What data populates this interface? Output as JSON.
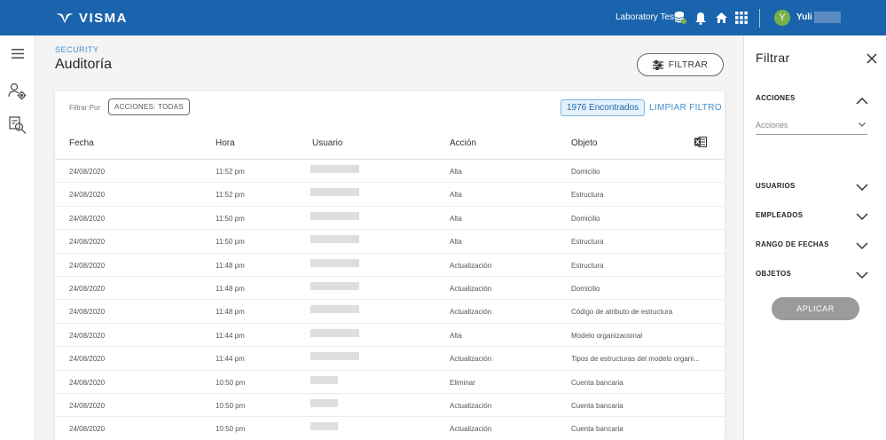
{
  "app": {
    "logo_text": "VISMA",
    "company": "Laboratory Test",
    "user_initial": "Y",
    "user_name": "Yuli"
  },
  "header": {
    "section": "SECURITY",
    "title": "Auditoría",
    "filter_button": "FILTRAR"
  },
  "toolbar": {
    "filter_by": "Filtrar Por",
    "chip": "ACCIONES: TODAS",
    "found": "1976 Encontrados",
    "clear": "LIMPIAR FILTRO"
  },
  "table": {
    "columns": [
      "Fecha",
      "Hora",
      "Usuario",
      "Acción",
      "Objeto"
    ],
    "rows": [
      {
        "fecha": "24/08/2020",
        "hora": "11:52 pm",
        "accion": "Alta",
        "objeto": "Domicilio",
        "user_blur": "long"
      },
      {
        "fecha": "24/08/2020",
        "hora": "11:52 pm",
        "accion": "Alta",
        "objeto": "Estructura",
        "user_blur": "long"
      },
      {
        "fecha": "24/08/2020",
        "hora": "11:50 pm",
        "accion": "Alta",
        "objeto": "Domicilio",
        "user_blur": "long"
      },
      {
        "fecha": "24/08/2020",
        "hora": "11:50 pm",
        "accion": "Alta",
        "objeto": "Estructura",
        "user_blur": "long"
      },
      {
        "fecha": "24/08/2020",
        "hora": "11:48 pm",
        "accion": "Actualización",
        "objeto": "Estructura",
        "user_blur": "long"
      },
      {
        "fecha": "24/08/2020",
        "hora": "11:48 pm",
        "accion": "Actualización",
        "objeto": "Domicilio",
        "user_blur": "long"
      },
      {
        "fecha": "24/08/2020",
        "hora": "11:48 pm",
        "accion": "Actualización",
        "objeto": "Código de atributo de estructura",
        "user_blur": "long"
      },
      {
        "fecha": "24/08/2020",
        "hora": "11:44 pm",
        "accion": "Alta",
        "objeto": "Modelo organizacional",
        "user_blur": "long"
      },
      {
        "fecha": "24/08/2020",
        "hora": "11:44 pm",
        "accion": "Actualización",
        "objeto": "Tipos de estructuras del modelo organi...",
        "user_blur": "long"
      },
      {
        "fecha": "24/08/2020",
        "hora": "10:50 pm",
        "accion": "Eliminar",
        "objeto": "Cuenta bancaria",
        "user_blur": "short"
      },
      {
        "fecha": "24/08/2020",
        "hora": "10:50 pm",
        "accion": "Actualización",
        "objeto": "Cuenta bancaria",
        "user_blur": "short"
      },
      {
        "fecha": "24/08/2020",
        "hora": "10:50 pm",
        "accion": "Actualización",
        "objeto": "Cuenta bancaria",
        "user_blur": "short"
      }
    ]
  },
  "filter_panel": {
    "title": "Filtrar",
    "sections": {
      "acciones": "ACCIONES",
      "acciones_placeholder": "Acciones",
      "usuarios": "USUARIOS",
      "empleados": "EMPLEADOS",
      "rango": "RANGO DE FECHAS",
      "objetos": "OBJETOS"
    },
    "apply": "APLICAR"
  },
  "icons": {
    "topbar": [
      "database-icon",
      "bell-icon",
      "home-icon",
      "app-grid-icon"
    ],
    "rail": [
      "menu-icon",
      "users-settings-icon",
      "audit-search-icon"
    ],
    "export": "excel-icon"
  },
  "colors": {
    "brand": "#1a64ad",
    "accent": "#3e8ed0",
    "avatar": "#79b04a",
    "apply_disabled": "#9b9b9b"
  }
}
